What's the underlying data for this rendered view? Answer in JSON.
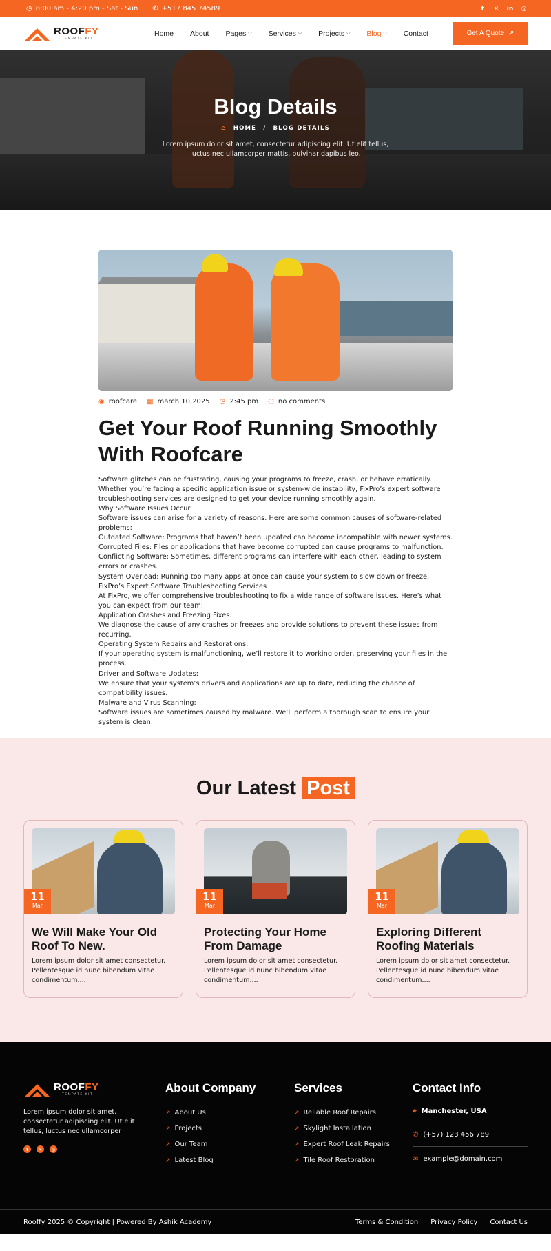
{
  "topbar": {
    "hours": "8:00 am - 4:20 pm - Sat - Sun",
    "phone": "+517 845 74589",
    "socials": [
      "facebook-icon",
      "x-icon",
      "linkedin-icon",
      "instagram-icon"
    ]
  },
  "header": {
    "logo_main": "ROOF",
    "logo_accent": "FY",
    "logo_sub": "TEMPATE KIT",
    "nav": [
      {
        "label": "Home",
        "dropdown": false
      },
      {
        "label": "About",
        "dropdown": false
      },
      {
        "label": "Pages",
        "dropdown": true
      },
      {
        "label": "Services",
        "dropdown": true
      },
      {
        "label": "Projects",
        "dropdown": true
      },
      {
        "label": "Blog",
        "dropdown": true,
        "active": true
      },
      {
        "label": "Contact",
        "dropdown": false
      }
    ],
    "cta": "Get A Quote"
  },
  "hero": {
    "title": "Blog Details",
    "crumb_home": "HOME",
    "crumb_sep": "/",
    "crumb_current": "BLOG DETAILS",
    "text": "Lorem ipsum dolor sit amet, consectetur adipiscing elit. Ut elit tellus, luctus nec ullamcorper mattis, pulvinar dapibus leo."
  },
  "article": {
    "author": "roofcare",
    "date": "march 10,2025",
    "time": "2:45 pm",
    "comments": "no comments",
    "title": "Get Your Roof Running Smoothly With Roofcare",
    "paragraphs": [
      "Software glitches can be frustrating, causing your programs to freeze, crash, or behave erratically. Whether you’re facing a specific application issue or system-wide instability, FixPro’s expert software troubleshooting services are designed to get your device running smoothly again.",
      "Why Software Issues Occur",
      "Software issues can arise for a variety of reasons. Here are some common causes of software-related problems:",
      "Outdated Software: Programs that haven’t been updated can become incompatible with newer systems.",
      "Corrupted Files: Files or applications that have become corrupted can cause programs to malfunction.",
      "Conflicting Software: Sometimes, different programs can interfere with each other, leading to system errors or crashes.",
      "System Overload: Running too many apps at once can cause your system to slow down or freeze.",
      "FixPro’s Expert Software Troubleshooting Services",
      "At FixPro, we offer comprehensive troubleshooting to fix a wide range of software issues. Here’s what you can expect from our team:",
      "Application Crashes and Freezing Fixes:",
      "We diagnose the cause of any crashes or freezes and provide solutions to prevent these issues from recurring.",
      "Operating System Repairs and Restorations:",
      "If your operating system is malfunctioning, we’ll restore it to working order, preserving your files in the process.",
      "Driver and Software Updates:",
      "We ensure that your system’s drivers and applications are up to date, reducing the chance of compatibility issues.",
      "Malware and Virus Scanning:",
      "Software issues are sometimes caused by malware. We’ll perform a thorough scan to ensure your system is clean."
    ]
  },
  "latest": {
    "title_main": "Our Latest",
    "title_accent": "Post",
    "posts": [
      {
        "day": "11",
        "month": "Mar",
        "title": "We Will Make Your Old Roof To New.",
        "excerpt": "Lorem ipsum dolor sit amet consectetur. Pellentesque id nunc bibendum vitae condimentum...."
      },
      {
        "day": "11",
        "month": "Mar",
        "title": "Protecting Your Home From Damage",
        "excerpt": "Lorem ipsum dolor sit amet consectetur. Pellentesque id nunc bibendum vitae condimentum...."
      },
      {
        "day": "11",
        "month": "Mar",
        "title": "Exploring Different Roofing Materials",
        "excerpt": "Lorem ipsum dolor sit amet consectetur. Pellentesque id nunc bibendum vitae condimentum...."
      }
    ]
  },
  "footer": {
    "logo_main": "ROOF",
    "logo_accent": "FY",
    "logo_sub": "TEMPATE KIT",
    "description": "Lorem ipsum dolor sit amet, consectetur adipiscing elit. Ut elit tellus, luctus nec ullamcorper",
    "about_title": "About Company",
    "about_links": [
      "About Us",
      "Projects",
      "Our Team",
      "Latest Blog"
    ],
    "services_title": "Services",
    "services_links": [
      "Reliable Roof Repairs",
      "Skylight Installation",
      "Expert Roof Leak Repairs",
      "Tile Roof Restoration"
    ],
    "contact_title": "Contact Info",
    "address": "Manchester, USA",
    "phone": "(+57) 123 456 789",
    "email": "example@domain.com",
    "copyright": "Rooffy 2025 © Copyright | Powered By Ashik Academy",
    "bottom_links": [
      "Terms & Condition",
      "Privacy Policy",
      "Contact Us"
    ]
  },
  "colors": {
    "accent": "#f46622",
    "latest_bg": "#fae8e8",
    "footer_bg": "#050505"
  }
}
